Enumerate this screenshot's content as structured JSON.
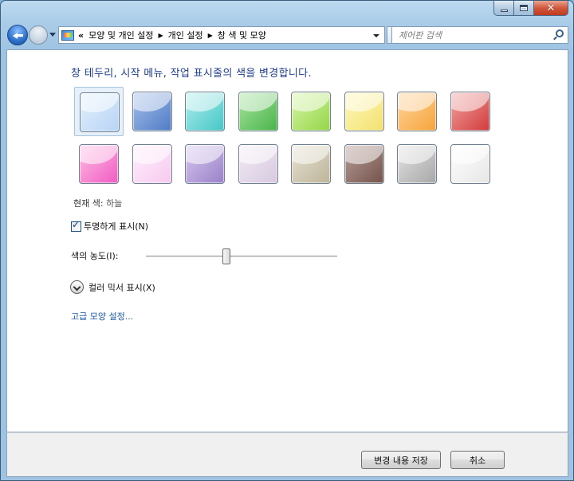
{
  "window": {
    "caption_buttons": [
      "minimize",
      "maximize",
      "close"
    ]
  },
  "nav": {
    "address_chevron": "«",
    "breadcrumbs": [
      "모양 및 개인 설정",
      "개인 설정",
      "창 색 및 모양"
    ],
    "search_placeholder": "제어판 검색"
  },
  "page": {
    "heading": "창 테두리, 시작 메뉴, 작업 표시줄의 색을 변경합니다.",
    "current_color_label": "현재 색:",
    "current_color_value": "하늘",
    "transparency_label": "투명하게 표시(N)",
    "transparency_checked": true,
    "intensity_label": "색의 농도(I):",
    "intensity_fraction": 0.42,
    "mixer_label": "컬러 믹서 표시(X)",
    "advanced_link": "고급 모양 설정..."
  },
  "swatches": [
    {
      "id": "sky",
      "top": "#e4f0fd",
      "bottom": "#b7d4f5",
      "selected": true
    },
    {
      "id": "twilight",
      "top": "#a6bfe9",
      "bottom": "#4f7bc6"
    },
    {
      "id": "sea",
      "top": "#b2eeee",
      "bottom": "#45c6c6"
    },
    {
      "id": "leaf",
      "top": "#a8e5a0",
      "bottom": "#49b449"
    },
    {
      "id": "lime",
      "top": "#d7f5a6",
      "bottom": "#94d648"
    },
    {
      "id": "lemon",
      "top": "#fff9bb",
      "bottom": "#f3e070"
    },
    {
      "id": "tangerine",
      "top": "#ffd59e",
      "bottom": "#f6a43a"
    },
    {
      "id": "ruby",
      "top": "#f1a4a4",
      "bottom": "#d33a3a"
    },
    {
      "id": "fuchsia",
      "top": "#ffbde6",
      "bottom": "#f05cc2"
    },
    {
      "id": "blush",
      "top": "#fff0fc",
      "bottom": "#f7c9ef"
    },
    {
      "id": "violet",
      "top": "#d7c8ef",
      "bottom": "#9a80c8"
    },
    {
      "id": "lavender",
      "top": "#f2ecf6",
      "bottom": "#d7c8df"
    },
    {
      "id": "taupe",
      "top": "#e6e1d1",
      "bottom": "#bdb49a"
    },
    {
      "id": "chocolate",
      "top": "#b69d97",
      "bottom": "#74534b"
    },
    {
      "id": "slate",
      "top": "#e3e3e3",
      "bottom": "#a7a7a7"
    },
    {
      "id": "frost",
      "top": "#ffffff",
      "bottom": "#e6e6e6"
    }
  ],
  "footer": {
    "save_label": "변경 내용 저장",
    "cancel_label": "취소"
  }
}
